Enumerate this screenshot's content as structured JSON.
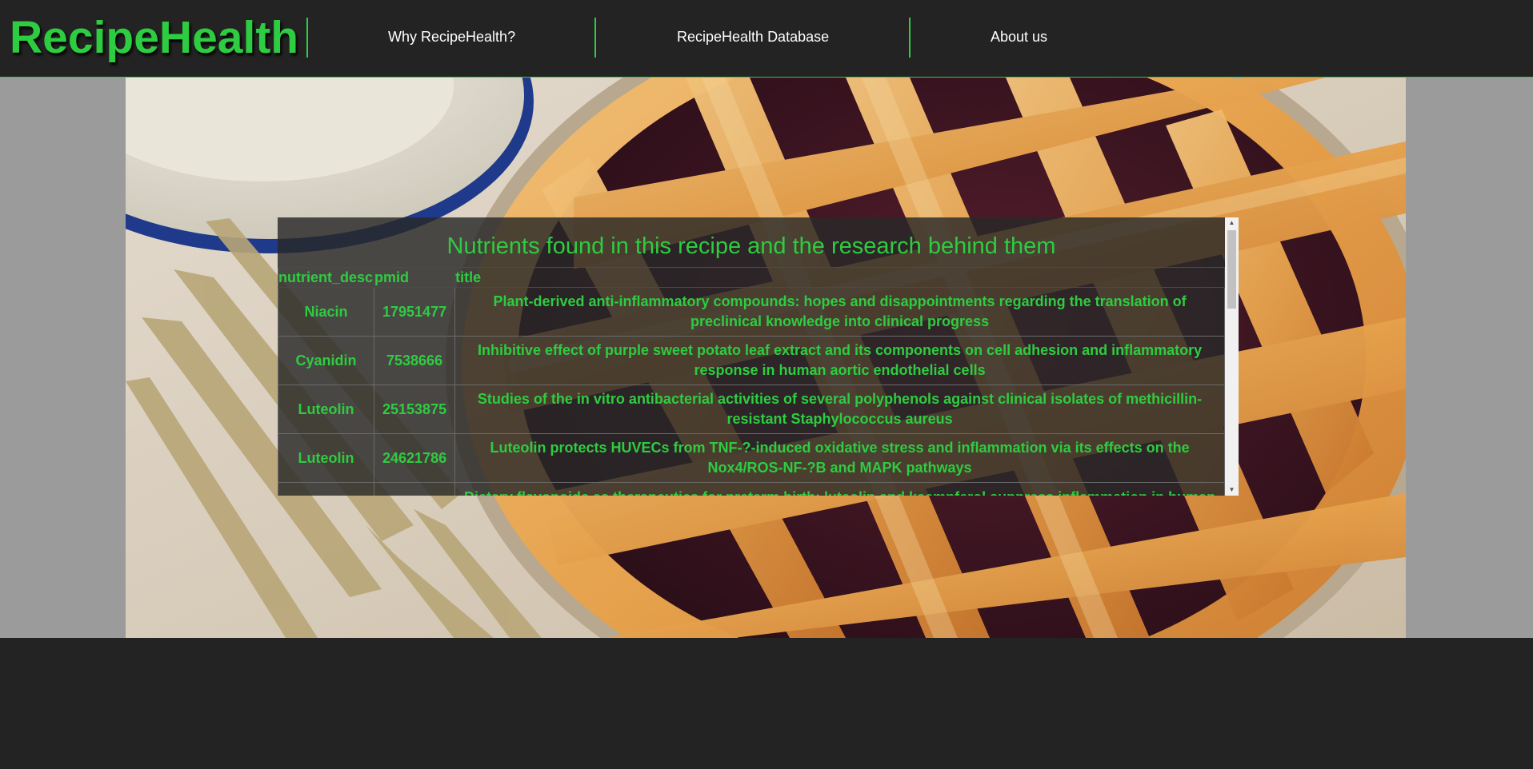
{
  "brand": "RecipeHealth",
  "nav": {
    "items": [
      {
        "label": "Why RecipeHealth?"
      },
      {
        "label": "RecipeHealth Database"
      },
      {
        "label": "About us"
      }
    ]
  },
  "panel": {
    "title": "Nutrients found in this recipe and the research behind them",
    "columns": [
      "nutrient_desc",
      "pmid",
      "title"
    ],
    "rows": [
      {
        "nutrient": "Niacin",
        "pmid": "17951477",
        "title": "Plant-derived anti-inflammatory compounds: hopes and disappointments regarding the translation of preclinical knowledge into clinical progress"
      },
      {
        "nutrient": "Cyanidin",
        "pmid": "7538666",
        "title": "Inhibitive effect of purple sweet potato leaf extract and its components on cell adhesion and inflammatory response in human aortic endothelial cells"
      },
      {
        "nutrient": "Luteolin",
        "pmid": "25153875",
        "title": "Studies of the in vitro antibacterial activities of several polyphenols against clinical isolates of methicillin-resistant Staphylococcus aureus"
      },
      {
        "nutrient": "Luteolin",
        "pmid": "24621786",
        "title": "Luteolin protects HUVECs from TNF-?-induced oxidative stress and inflammation via its effects on the Nox4/ROS-NF-?B and MAPK pathways"
      },
      {
        "nutrient": "",
        "pmid": "",
        "title": "Dietary flavonoids as therapeutics for preterm birth: luteolin and kaempferol suppress inflammation in human"
      }
    ]
  },
  "colors": {
    "accent": "#2ecc40",
    "nav_bg": "#232323",
    "stage_bg": "#9b9b9b"
  },
  "icons": {
    "scroll_up": "scroll-up-arrow-icon",
    "scroll_down": "scroll-down-arrow-icon"
  }
}
